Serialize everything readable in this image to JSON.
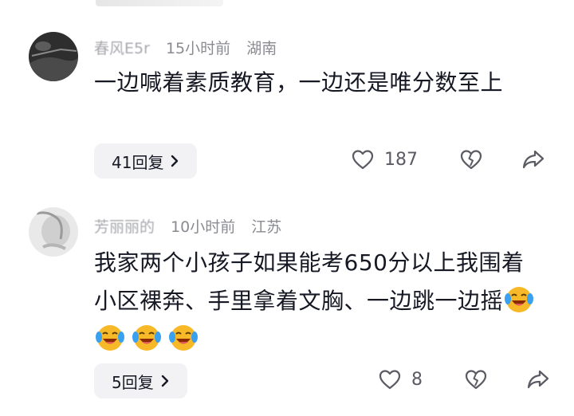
{
  "comments": [
    {
      "username": "春风E5r",
      "time": "15小时前",
      "location": "湖南",
      "text": "一边喊着素质教育，一边还是唯分数至上",
      "replies_label": "41回复",
      "likes": "187"
    },
    {
      "username": "芳丽丽的",
      "time": "10小时前",
      "location": "江苏",
      "text": "我家两个小孩子如果能考650分以上我围着小区裸奔、手里拿着文胸、一边跳一边摇",
      "emoji_icon": "laughing-crying-emoji",
      "emoji_count": 4,
      "replies_label": "5回复",
      "likes": "8"
    }
  ],
  "icons": {
    "like": "heart-outline-icon",
    "dislike": "broken-heart-icon",
    "share": "share-arrow-icon",
    "replies": "chevron-right-icon"
  },
  "colors": {
    "text": "#161823",
    "meta": "#8a8b91",
    "reply_bg": "#f2f2f4"
  }
}
